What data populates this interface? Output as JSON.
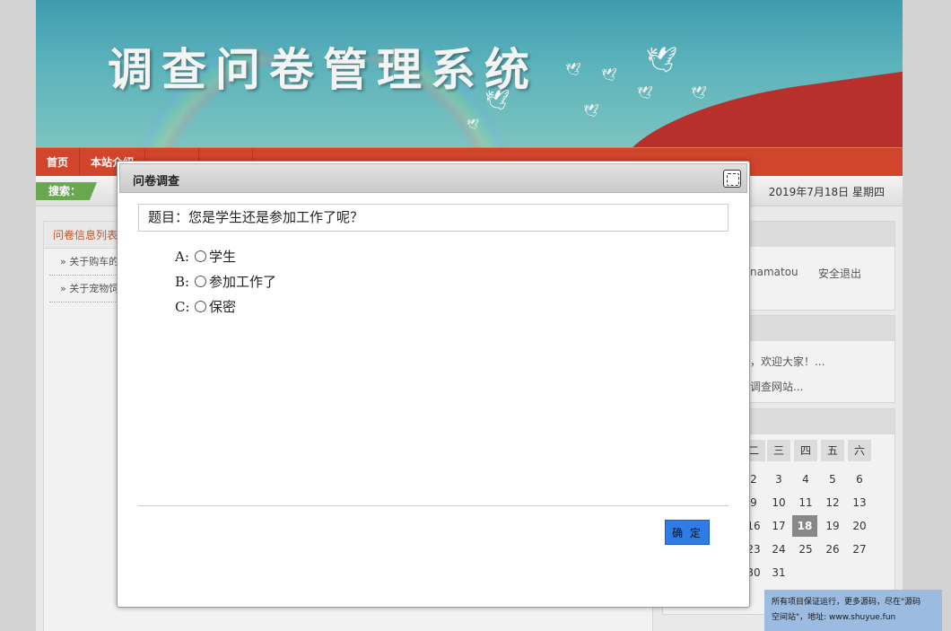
{
  "banner": {
    "title": "调查问卷管理系统"
  },
  "nav": {
    "items": [
      "首页",
      "本站介绍",
      "",
      ""
    ]
  },
  "subbar": {
    "search_label": "搜索：",
    "date": "2019年7月18日 星期四"
  },
  "left_panel": {
    "title": "问卷信息列表",
    "items": [
      "关于购车的一",
      "关于宠物饲养"
    ]
  },
  "right": {
    "user": "namatou",
    "logout": "安全退出",
    "notice1": "，欢迎大家！...",
    "notice2": "调查网站..."
  },
  "calendar": {
    "headers": [
      "二",
      "三",
      "四",
      "五",
      "六"
    ],
    "rows": [
      [
        "2",
        "3",
        "4",
        "5",
        "6"
      ],
      [
        "9",
        "10",
        "11",
        "12",
        "13"
      ],
      [
        "16",
        "17",
        "18",
        "19",
        "20"
      ],
      [
        "23",
        "24",
        "25",
        "26",
        "27"
      ],
      [
        "30",
        "31",
        "",
        "",
        ""
      ]
    ],
    "today": "18"
  },
  "modal": {
    "title": "问卷调查",
    "question": "题目：您是学生还是参加工作了呢？",
    "options": [
      {
        "letter": "A:",
        "label": "学生"
      },
      {
        "letter": "B:",
        "label": "参加工作了"
      },
      {
        "letter": "C:",
        "label": "保密"
      }
    ],
    "confirm": "确 定"
  },
  "promo": {
    "line1": "所有项目保证运行，更多源码，尽在\"源码",
    "line2": "空间站\"，地址: www.shuyue.fun"
  }
}
